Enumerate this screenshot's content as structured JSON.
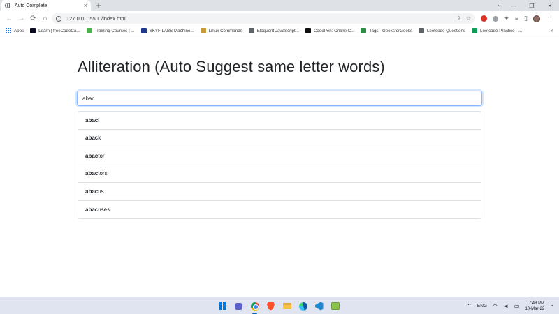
{
  "browser": {
    "tab_title": "Auto Complete",
    "tab_close": "×",
    "new_tab": "+",
    "url": "127.0.0.1:5500/index.html",
    "win_minimize": "—",
    "win_restore": "❐",
    "win_close": "✕",
    "tab_search": "⌄"
  },
  "toolbar": {
    "back": "←",
    "forward": "→",
    "reload": "⟳",
    "home": "⌂",
    "share": "⇪",
    "star": "☆",
    "puzzle": "✦",
    "menu": "⋮",
    "sidepanel": "▯",
    "reading": "≡"
  },
  "bookmarks": [
    {
      "label": "Apps",
      "color": "#1a73e8"
    },
    {
      "label": "Learn | freeCodeCa...",
      "color": "#0a0a23"
    },
    {
      "label": "Training Courses | ...",
      "color": "#4caf50"
    },
    {
      "label": "SKYFILABS Machine...",
      "color": "#1e3a8a"
    },
    {
      "label": "Linux Commands",
      "color": "#c79a3a"
    },
    {
      "label": "Eloquent JavaScript...",
      "color": "#5f6368"
    },
    {
      "label": "CodePen: Online C...",
      "color": "#111111"
    },
    {
      "label": "Tags - GeeksforGeeks",
      "color": "#2f8d46"
    },
    {
      "label": "Leetcode Questions",
      "color": "#5f6368"
    },
    {
      "label": "Leetcode Practice - ...",
      "color": "#0f9d58"
    }
  ],
  "bookmarks_more": "»",
  "page": {
    "title": "Alliteration (Auto Suggest same letter words)",
    "query": "abac"
  },
  "suggestions": [
    {
      "match": "abac",
      "rest": "i"
    },
    {
      "match": "abac",
      "rest": "k"
    },
    {
      "match": "abac",
      "rest": "tor"
    },
    {
      "match": "abac",
      "rest": "tors"
    },
    {
      "match": "abac",
      "rest": "us"
    },
    {
      "match": "abac",
      "rest": "uses"
    }
  ],
  "taskbar": {
    "chevron": "⌃",
    "language": "ENG",
    "wifi": "◠",
    "sound": "◄",
    "battery": "▭",
    "time": "7:48 PM",
    "date": "10-Mar-22",
    "notifications": "◔"
  },
  "colors": {
    "focus_ring": "#86b7fe",
    "list_border": "#dee2e6",
    "text": "#212529"
  }
}
